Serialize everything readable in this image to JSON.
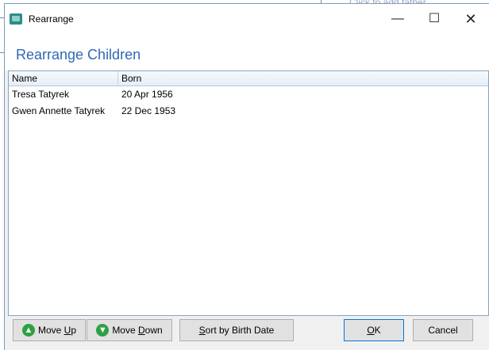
{
  "background": {
    "parent_hint": "Click to add father"
  },
  "titlebar": {
    "title": "Rearrange",
    "minimize": "—",
    "maximize": "☐",
    "close": "✕"
  },
  "heading": "Rearrange Children",
  "list": {
    "columns": [
      "Name",
      "Born"
    ],
    "rows": [
      {
        "name": "Tresa Tatyrek",
        "born": "20 Apr 1956"
      },
      {
        "name": "Gwen Annette Tatyrek",
        "born": "22 Dec 1953"
      }
    ]
  },
  "buttons": {
    "move_up": {
      "pre": "Move ",
      "ul": "U",
      "post": "p",
      "icon": "arrow-up-icon",
      "icon_glyph": "▲"
    },
    "move_down": {
      "pre": "Move ",
      "ul": "D",
      "post": "own",
      "icon": "arrow-down-icon",
      "icon_glyph": "▼"
    },
    "sort": {
      "pre": "",
      "ul": "S",
      "post": "ort by Birth Date"
    },
    "ok": {
      "pre": "",
      "ul": "O",
      "post": "K"
    },
    "cancel": {
      "label": "Cancel"
    }
  },
  "colors": {
    "heading": "#2f68b5",
    "icon_green": "#2ea043",
    "ok_border": "#0078d7"
  }
}
